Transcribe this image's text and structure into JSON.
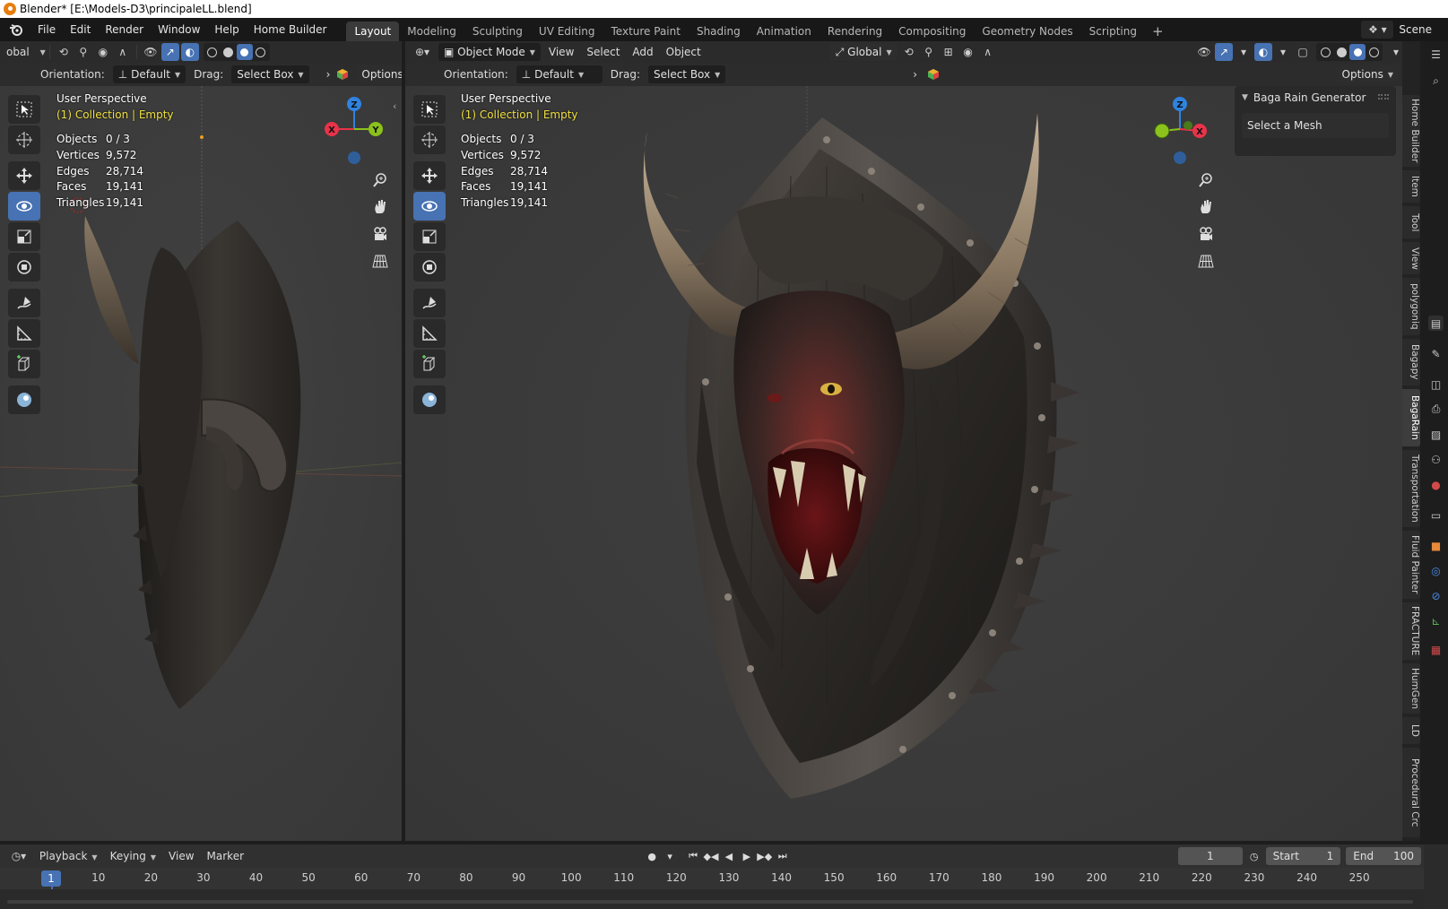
{
  "window": {
    "title": "Blender* [E:\\Models-D3\\principaleLL.blend]"
  },
  "menubar": {
    "items": [
      "File",
      "Edit",
      "Render",
      "Window",
      "Help",
      "Home Builder"
    ],
    "workspaces": [
      "Layout",
      "Modeling",
      "Sculpting",
      "UV Editing",
      "Texture Paint",
      "Shading",
      "Animation",
      "Rendering",
      "Compositing",
      "Geometry Nodes",
      "Scripting"
    ],
    "add_symbol": "+",
    "scene": "Scene"
  },
  "left_viewport": {
    "transform_label": "obal",
    "orientation_label": "Orientation:",
    "orientation_value": "Default",
    "drag_label": "Drag:",
    "drag_value": "Select Box",
    "options_label": "Options",
    "view_name": "User Perspective",
    "collection": "(1) Collection | Empty",
    "stats": [
      {
        "label": "Objects",
        "value": "0 / 3"
      },
      {
        "label": "Vertices",
        "value": "9,572"
      },
      {
        "label": "Edges",
        "value": "28,714"
      },
      {
        "label": "Faces",
        "value": "19,141"
      },
      {
        "label": "Triangles",
        "value": "19,141"
      }
    ],
    "gizmo": {
      "z": "Z",
      "x": "X",
      "y": "Y"
    }
  },
  "right_viewport": {
    "mode": "Object Mode",
    "menus": [
      "View",
      "Select",
      "Add",
      "Object"
    ],
    "transform": "Global",
    "orientation_label": "Orientation:",
    "orientation_value": "Default",
    "drag_label": "Drag:",
    "drag_value": "Select Box",
    "options_label": "Options",
    "view_name": "User Perspective",
    "collection": "(1) Collection | Empty",
    "stats": [
      {
        "label": "Objects",
        "value": "0 / 3"
      },
      {
        "label": "Vertices",
        "value": "9,572"
      },
      {
        "label": "Edges",
        "value": "28,714"
      },
      {
        "label": "Faces",
        "value": "19,141"
      },
      {
        "label": "Triangles",
        "value": "19,141"
      }
    ],
    "gizmo": {
      "z": "Z",
      "x": "X"
    },
    "npanel": {
      "title": "Baga Rain Generator",
      "body": "Select a Mesh"
    }
  },
  "sidebar_tabs": [
    "Home Builder",
    "Item",
    "Tool",
    "View",
    "polygoniq",
    "Bagapy",
    "BagaRain",
    "Transportation",
    "Fluid Painter",
    "FRACTURE",
    "HumGen",
    "LD",
    "Procedural Crc"
  ],
  "timeline": {
    "menus": [
      "Playback",
      "Keying",
      "View",
      "Marker"
    ],
    "current_frame": "1",
    "start_label": "Start",
    "start_value": "1",
    "end_label": "End",
    "end_value": "100",
    "ruler": [
      "10",
      "20",
      "30",
      "40",
      "50",
      "60",
      "70",
      "80",
      "90",
      "100",
      "110",
      "120",
      "130",
      "140",
      "150",
      "160",
      "170",
      "180",
      "190",
      "200",
      "210",
      "220",
      "230",
      "240",
      "250"
    ]
  },
  "colors": {
    "accent": "#4772b3",
    "collection": "#f0e040",
    "axis_x": "#e8334a",
    "axis_y": "#8bc21c",
    "axis_z": "#2f83e0"
  }
}
